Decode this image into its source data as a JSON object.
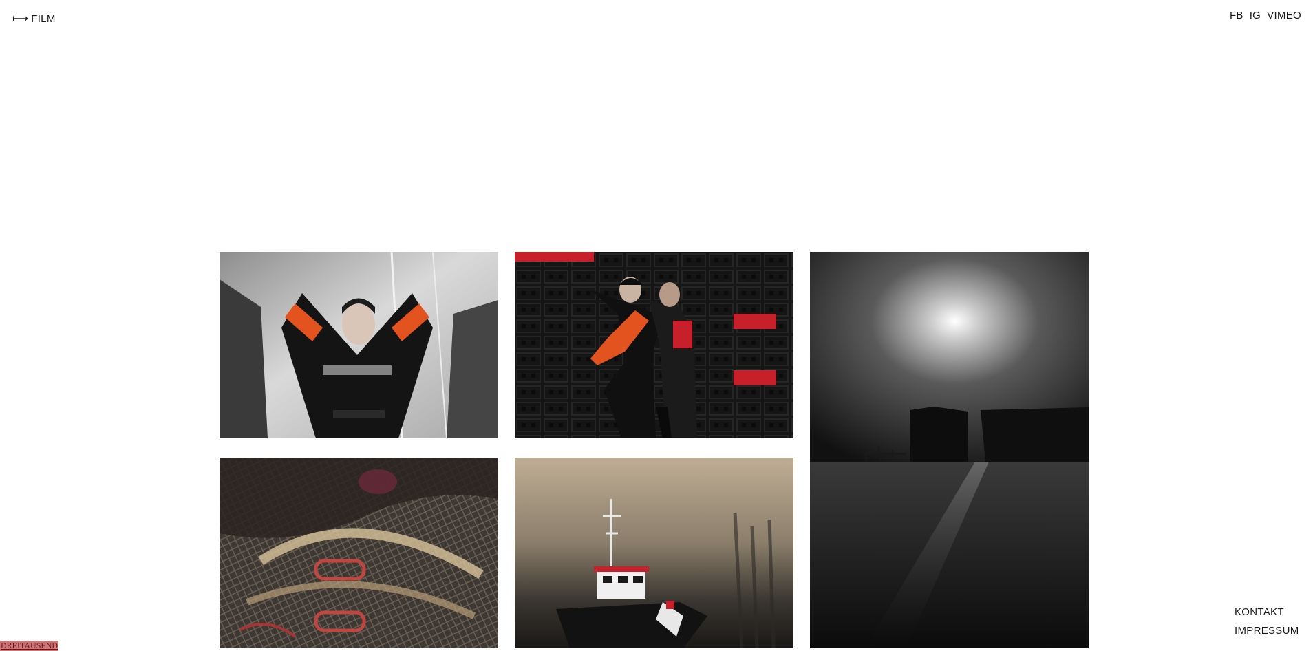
{
  "nav": {
    "arrow_glyph": "⟼",
    "film_label": "FILM"
  },
  "social": {
    "fb": "FB",
    "ig": "IG",
    "vimeo": "VIMEO"
  },
  "footer": {
    "kontakt": "KONTAKT",
    "impressum": "IMPRESSUM"
  },
  "brand_tag": "DREITAUSEND",
  "colors": {
    "background": "#ffffff",
    "text": "#1a1a1a",
    "brand_tag_bg": "#c9787a",
    "brand_tag_text": "#7a0e14",
    "accent_orange": "#e2531f",
    "accent_red": "#c8202a"
  },
  "thumbnails": [
    {
      "subject": "portrait-harley-davidson-jacket"
    },
    {
      "subject": "two-models-black-crates"
    },
    {
      "subject": "backlit-harbour-buildings"
    },
    {
      "subject": "fishing-nets-closeup"
    },
    {
      "subject": "fishing-boat-in-fog"
    }
  ]
}
